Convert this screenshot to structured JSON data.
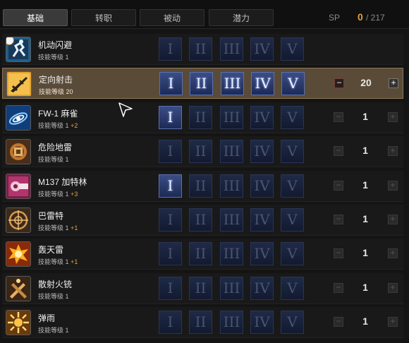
{
  "tabs": [
    {
      "label": "基础",
      "active": true
    },
    {
      "label": "转职",
      "active": false
    },
    {
      "label": "被动",
      "active": false
    },
    {
      "label": "潜力",
      "active": false
    }
  ],
  "sp": {
    "label": "SP",
    "current": "0",
    "total": "/ 217"
  },
  "level_prefix": "技能等级",
  "roman_labels": [
    "I",
    "II",
    "III",
    "IV",
    "V"
  ],
  "skills": [
    {
      "name": "机动闪避",
      "level_text": "1",
      "bonus": "",
      "unlocked": 0,
      "show_controls": false,
      "value": "",
      "icon": "dodge-icon"
    },
    {
      "name": "定向射击",
      "level_text": "20",
      "bonus": "",
      "unlocked": 5,
      "show_controls": true,
      "value": "20",
      "icon": "rifle-icon"
    },
    {
      "name": "FW-1 麻雀",
      "level_text": "1",
      "bonus": "+2",
      "unlocked": 1,
      "show_controls": true,
      "value": "1",
      "icon": "sparrow-icon"
    },
    {
      "name": "危险地雷",
      "level_text": "1",
      "bonus": "",
      "unlocked": 0,
      "show_controls": true,
      "value": "1",
      "icon": "mine-icon"
    },
    {
      "name": "M137 加特林",
      "level_text": "1",
      "bonus": "+3",
      "unlocked": 1,
      "show_controls": true,
      "value": "1",
      "icon": "gatling-icon"
    },
    {
      "name": "巴雷特",
      "level_text": "1",
      "bonus": "+1",
      "unlocked": 0,
      "show_controls": true,
      "value": "1",
      "icon": "sniper-icon"
    },
    {
      "name": "轰天雷",
      "level_text": "1",
      "bonus": "+1",
      "unlocked": 0,
      "show_controls": true,
      "value": "1",
      "icon": "explosion-icon"
    },
    {
      "name": "散射火铳",
      "level_text": "1",
      "bonus": "",
      "unlocked": 0,
      "show_controls": true,
      "value": "1",
      "icon": "shotgun-icon"
    },
    {
      "name": "弹雨",
      "level_text": "1",
      "bonus": "",
      "unlocked": 0,
      "show_controls": true,
      "value": "1",
      "icon": "bullet-rain-icon"
    }
  ]
}
